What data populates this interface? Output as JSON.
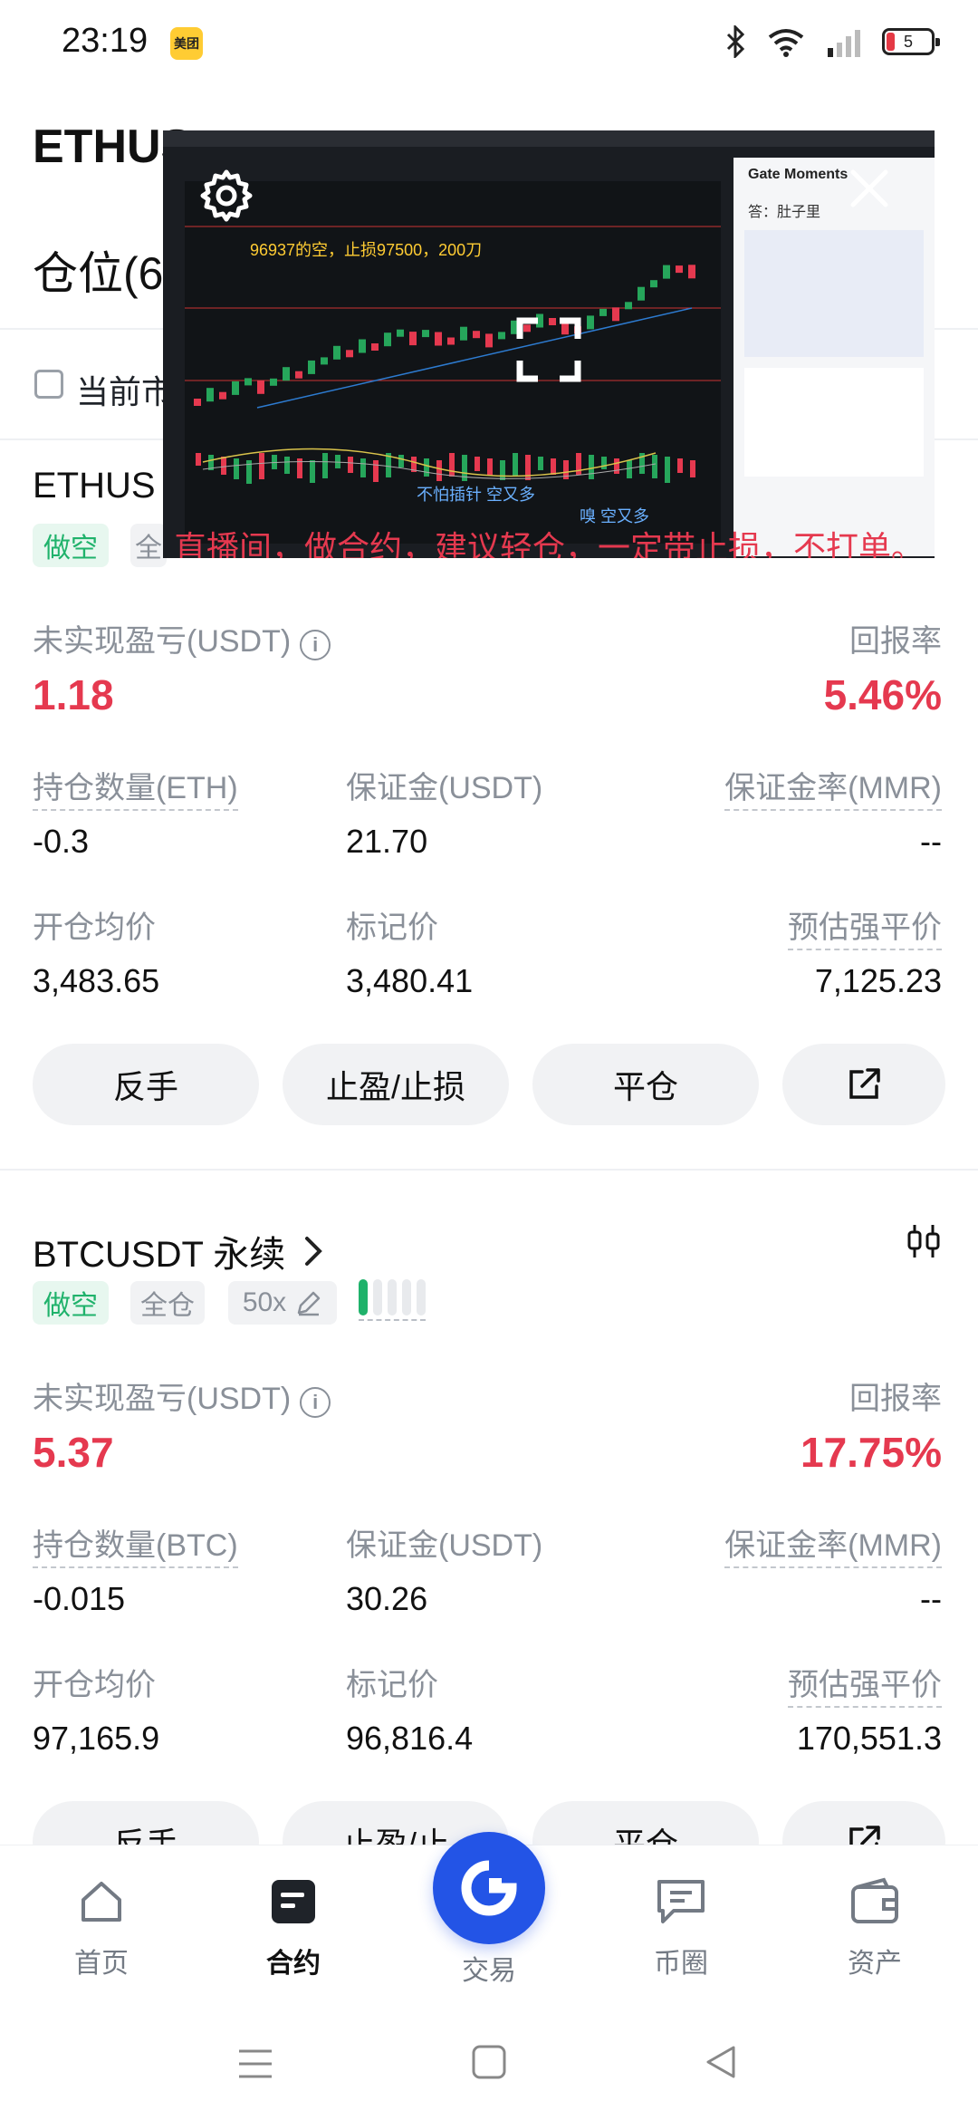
{
  "status_bar": {
    "time": "23:19",
    "app_badge": "美团",
    "battery": "5"
  },
  "header": {
    "title": "ETHUS",
    "positions_title": "仓位(6"
  },
  "filter": {
    "current_market_label": "当前市"
  },
  "positions": [
    {
      "symbol": "ETHUS",
      "tags": {
        "side": "做空",
        "margin_mode": "全"
      },
      "pnl_label": "未实现盈亏(USDT)",
      "pnl": "1.18",
      "roe_label": "回报率",
      "roe": "5.46%",
      "qty_label": "持仓数量(ETH)",
      "qty": "-0.3",
      "margin_label": "保证金(USDT)",
      "margin": "21.70",
      "mmr_label": "保证金率(MMR)",
      "mmr": "--",
      "entry_label": "开仓均价",
      "entry": "3,483.65",
      "mark_label": "标记价",
      "mark": "3,480.41",
      "liq_label": "预估强平价",
      "liq": "7,125.23",
      "actions": [
        "反手",
        "止盈/止损",
        "平仓"
      ]
    },
    {
      "symbol": "BTCUSDT 永续",
      "tags": {
        "side": "做空",
        "margin_mode": "全仓",
        "leverage": "50x"
      },
      "leverage_level": 0.2,
      "pnl_label": "未实现盈亏(USDT)",
      "pnl": "5.37",
      "roe_label": "回报率",
      "roe": "17.75%",
      "qty_label": "持仓数量(BTC)",
      "qty": "-0.015",
      "margin_label": "保证金(USDT)",
      "margin": "30.26",
      "mmr_label": "保证金率(MMR)",
      "mmr": "--",
      "entry_label": "开仓均价",
      "entry": "97,165.9",
      "mark_label": "标记价",
      "mark": "96,816.4",
      "liq_label": "预估强平价",
      "liq": "170,551.3",
      "actions": [
        "反手",
        "止盈/止",
        "平仓"
      ]
    }
  ],
  "bottom_nav": {
    "home": "首页",
    "contracts": "合约",
    "trade": "交易",
    "community": "币圈",
    "assets": "资产"
  },
  "pip": {
    "chart_note": "96937的空，止损97500，200刀",
    "subtitle": "直播间，做合约，建议轻仓，一定带止损，不打单。",
    "caption1": "不怕插针 空又多",
    "caption2": "嗅 空又多",
    "side_title": "Gate Moments",
    "side_sub": "答：肚子里"
  },
  "colors": {
    "short_green": "#1fb26b",
    "loss_red": "#e5394f",
    "brand_blue": "#2354e6"
  }
}
